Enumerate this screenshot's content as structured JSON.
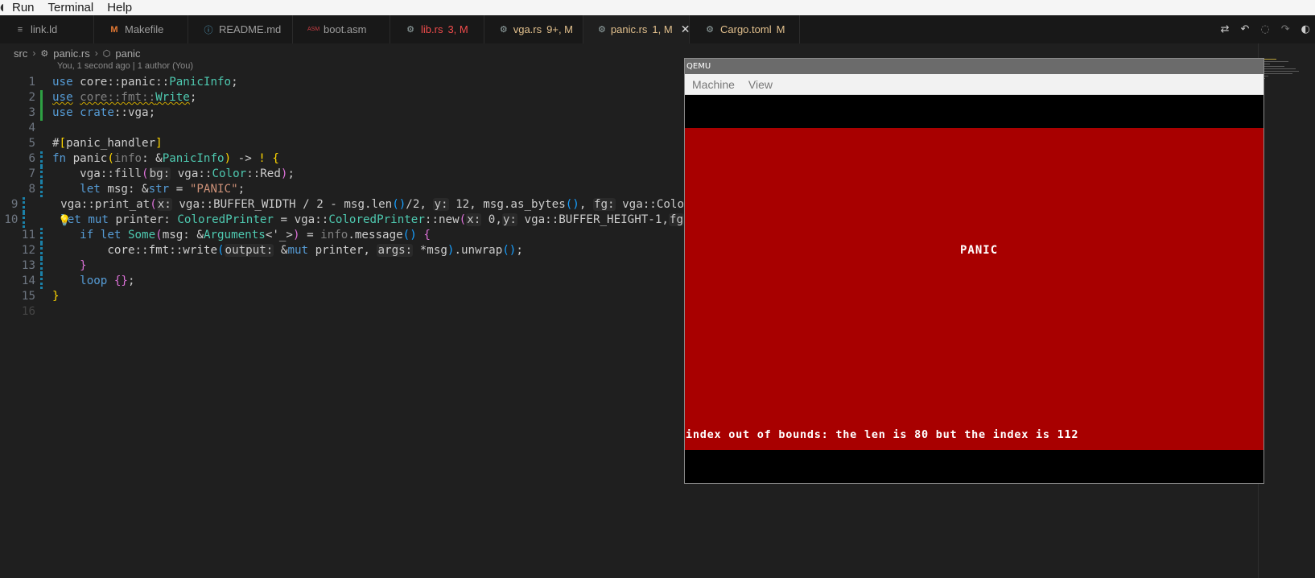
{
  "menubar": {
    "items": [
      "Run",
      "Terminal",
      "Help"
    ]
  },
  "tabs": [
    {
      "icon": "list-icon",
      "glyph": "≡",
      "label": "link.ld",
      "badge": ""
    },
    {
      "icon": "makefile-icon",
      "glyph": "M",
      "label": "Makefile",
      "badge": ""
    },
    {
      "icon": "info-icon",
      "glyph": "ⓘ",
      "label": "README.md",
      "badge": ""
    },
    {
      "icon": "asm-icon",
      "glyph": "ASM",
      "label": "boot.asm",
      "badge": ""
    },
    {
      "icon": "rust-icon",
      "glyph": "⚙",
      "label": "lib.rs",
      "badge": "3, M"
    },
    {
      "icon": "rust-icon",
      "glyph": "⚙",
      "label": "vga.rs",
      "badge": "9+, M"
    },
    {
      "icon": "rust-icon",
      "glyph": "⚙",
      "label": "panic.rs",
      "badge": "1, M"
    },
    {
      "icon": "gear-icon",
      "glyph": "⚙",
      "label": "Cargo.toml",
      "badge": "M"
    }
  ],
  "breadcrumb": {
    "folder": "src",
    "file": "panic.rs",
    "symbol": "panic"
  },
  "blame": "You, 1 second ago | 1 author (You)",
  "line_numbers": [
    "1",
    "2",
    "3",
    "4",
    "5",
    "6",
    "7",
    "8",
    "9",
    "10",
    "11",
    "12",
    "13",
    "14",
    "15",
    "16"
  ],
  "qemu": {
    "title": "QEMU",
    "menu": [
      "Machine",
      "View"
    ],
    "screen_center_text": "PANIC",
    "screen_bottom_text": "index out of bounds: the len is 80 but the index is 112"
  },
  "colors": {
    "vga_red": "#a80000",
    "accent_modified": "#e2c08d",
    "error": "#f14c4c"
  }
}
